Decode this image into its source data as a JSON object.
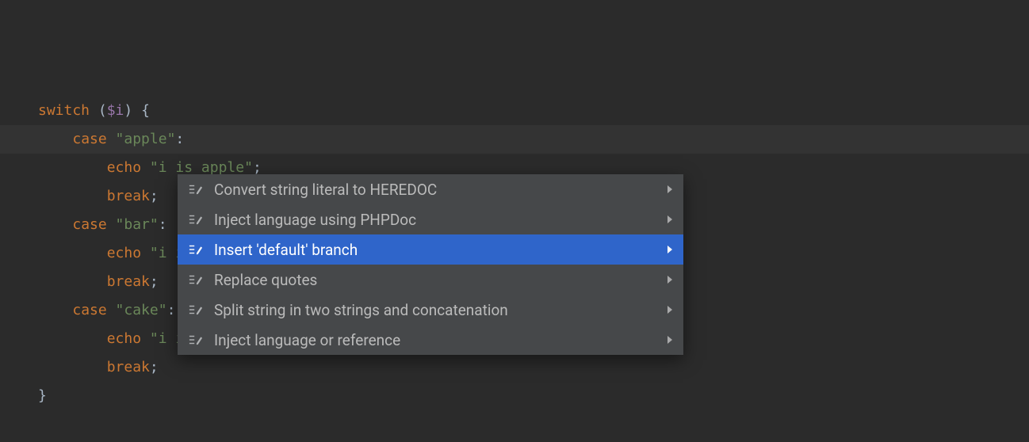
{
  "colors": {
    "bg": "#2B2B2B",
    "kw": "#CC7832",
    "var": "#9876AA",
    "str": "#6A8759",
    "txt": "#A9B7C6",
    "popup_bg": "#46484A",
    "popup_sel": "#2F65CA"
  },
  "code": {
    "lines": [
      [
        {
          "t": "switch ",
          "c": "kw"
        },
        {
          "t": "(",
          "c": "txt"
        },
        {
          "t": "$i",
          "c": "var"
        },
        {
          "t": ") {",
          "c": "txt"
        }
      ],
      [
        {
          "t": "    ",
          "c": "txt"
        },
        {
          "t": "case ",
          "c": "kw"
        },
        {
          "t": "\"apple\"",
          "c": "str"
        },
        {
          "t": ":",
          "c": "txt"
        }
      ],
      [
        {
          "t": "        ",
          "c": "txt"
        },
        {
          "t": "echo ",
          "c": "kw"
        },
        {
          "t": "\"i is apple\"",
          "c": "str"
        },
        {
          "t": ";",
          "c": "txt"
        }
      ],
      [
        {
          "t": "        ",
          "c": "txt"
        },
        {
          "t": "break",
          "c": "kw"
        },
        {
          "t": ";",
          "c": "txt"
        }
      ],
      [
        {
          "t": "    ",
          "c": "txt"
        },
        {
          "t": "case ",
          "c": "kw"
        },
        {
          "t": "\"bar\"",
          "c": "str"
        },
        {
          "t": ":",
          "c": "txt"
        }
      ],
      [
        {
          "t": "        ",
          "c": "txt"
        },
        {
          "t": "echo ",
          "c": "kw"
        },
        {
          "t": "\"i is bar\"",
          "c": "str"
        },
        {
          "t": ";",
          "c": "txt"
        }
      ],
      [
        {
          "t": "        ",
          "c": "txt"
        },
        {
          "t": "break",
          "c": "kw"
        },
        {
          "t": ";",
          "c": "txt"
        }
      ],
      [
        {
          "t": "    ",
          "c": "txt"
        },
        {
          "t": "case ",
          "c": "kw"
        },
        {
          "t": "\"cake\"",
          "c": "str"
        },
        {
          "t": ":",
          "c": "txt"
        }
      ],
      [
        {
          "t": "        ",
          "c": "txt"
        },
        {
          "t": "echo ",
          "c": "kw"
        },
        {
          "t": "\"i is cake\"",
          "c": "str"
        },
        {
          "t": ";",
          "c": "txt"
        }
      ],
      [
        {
          "t": "        ",
          "c": "txt"
        },
        {
          "t": "break",
          "c": "kw"
        },
        {
          "t": ";",
          "c": "txt"
        }
      ],
      [
        {
          "t": "}",
          "c": "txt"
        }
      ]
    ],
    "highlighted_line_index": 4
  },
  "popup": {
    "items": [
      {
        "label": "Convert string literal to HEREDOC",
        "selected": false,
        "has_submenu": true,
        "icon": "intention-edit-icon"
      },
      {
        "label": "Inject language using PHPDoc",
        "selected": false,
        "has_submenu": true,
        "icon": "intention-edit-icon"
      },
      {
        "label": "Insert 'default' branch",
        "selected": true,
        "has_submenu": true,
        "icon": "intention-edit-icon"
      },
      {
        "label": "Replace quotes",
        "selected": false,
        "has_submenu": true,
        "icon": "intention-edit-icon"
      },
      {
        "label": "Split string in two strings and concatenation",
        "selected": false,
        "has_submenu": true,
        "icon": "intention-edit-icon"
      },
      {
        "label": "Inject language or reference",
        "selected": false,
        "has_submenu": true,
        "icon": "intention-edit-icon"
      }
    ]
  }
}
